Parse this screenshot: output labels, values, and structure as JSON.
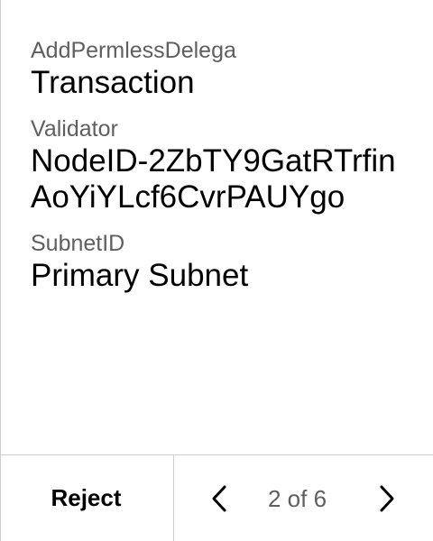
{
  "fields": [
    {
      "label": "AddPermlessDelega",
      "value": "Transaction"
    },
    {
      "label": "Validator",
      "value": "NodeID-2ZbTY9GatRTrfinAoYiYLcf6CvrPAUYgo"
    },
    {
      "label": "SubnetID",
      "value": "Primary Subnet"
    }
  ],
  "footer": {
    "reject_label": "Reject",
    "page_indicator": "2 of 6",
    "prev_icon": "chevron-left-icon",
    "next_icon": "chevron-right-icon"
  },
  "colors": {
    "label": "#5f5f5f",
    "value": "#000000",
    "divider": "#cfcfcf",
    "background": "#ffffff"
  }
}
